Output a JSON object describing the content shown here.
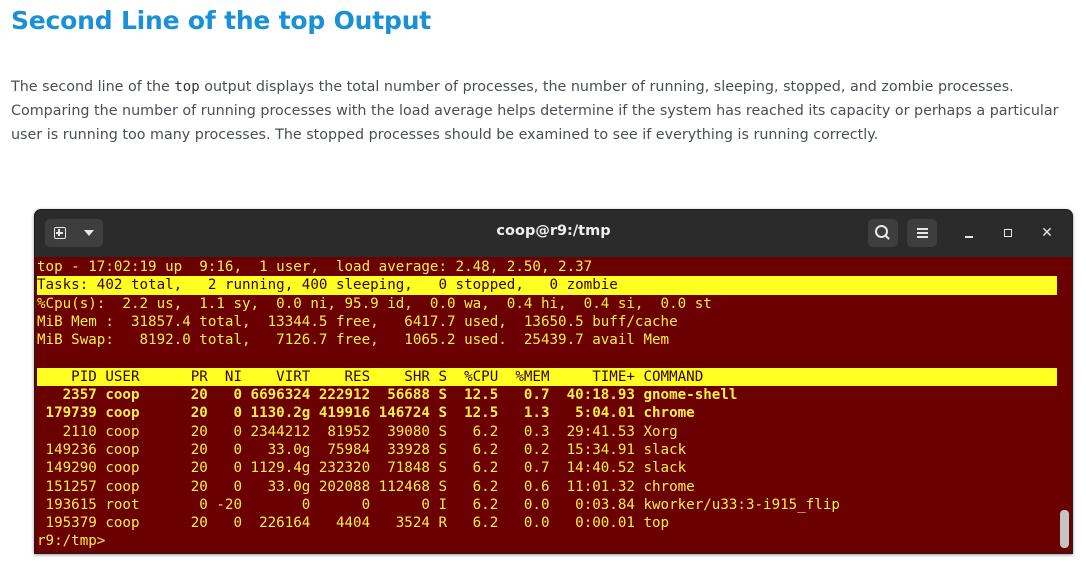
{
  "article": {
    "heading": "Second Line of the top Output",
    "para_before_code": "The second line of the ",
    "para_code": "top",
    "para_after_code": " output displays the total number of processes, the number of running, sleeping, stopped, and zombie processes. Comparing the number of running processes with the load average helps determine if the system has reached its capacity or perhaps a particular user is running too many processes. The stopped processes should be examined to see if everything is running correctly."
  },
  "terminal": {
    "title": "coop@r9:/tmp",
    "colors": {
      "background": "#6b0000",
      "text": "#ffee44",
      "highlight": "#ffff22"
    },
    "icons": [
      "new-tab-icon",
      "chevron-down-icon",
      "search-icon",
      "hamburger-menu-icon",
      "minimize-icon",
      "maximize-icon",
      "close-icon"
    ],
    "summary": [
      "top - 17:02:19 up  9:16,  1 user,  load average: 2.48, 2.50, 2.37",
      "Tasks: 402 total,   2 running, 400 sleeping,   0 stopped,   0 zombie",
      "%Cpu(s):  2.2 us,  1.1 sy,  0.0 ni, 95.9 id,  0.0 wa,  0.4 hi,  0.4 si,  0.0 st",
      "MiB Mem :  31857.4 total,  13344.5 free,   6417.7 used,  13650.5 buff/cache",
      "MiB Swap:   8192.0 total,   7126.7 free,   1065.2 used.  25439.7 avail Mem"
    ],
    "header": "    PID USER      PR  NI    VIRT    RES    SHR S  %CPU  %MEM     TIME+ COMMAND",
    "processes": [
      "   2357 coop      20   0 6696324 222912  56688 S  12.5   0.7  40:18.93 gnome-shell",
      " 179739 coop      20   0 1130.2g 419916 146724 S  12.5   1.3   5:04.01 chrome",
      "   2110 coop      20   0 2344212  81952  39080 S   6.2   0.3  29:41.53 Xorg",
      " 149236 coop      20   0   33.0g  75984  33928 S   6.2   0.2  15:34.91 slack",
      " 149290 coop      20   0 1129.4g 232320  71848 S   6.2   0.7  14:40.52 slack",
      " 151257 coop      20   0   33.0g 202088 112468 S   6.2   0.6  11:01.32 chrome",
      " 193615 root       0 -20       0      0      0 I   6.2   0.0   0:03.84 kworker/u33:3-i915_flip",
      " 195379 coop      20   0  226164   4404   3524 R   6.2   0.0   0:00.01 top"
    ],
    "prompt": "r9:/tmp>"
  }
}
